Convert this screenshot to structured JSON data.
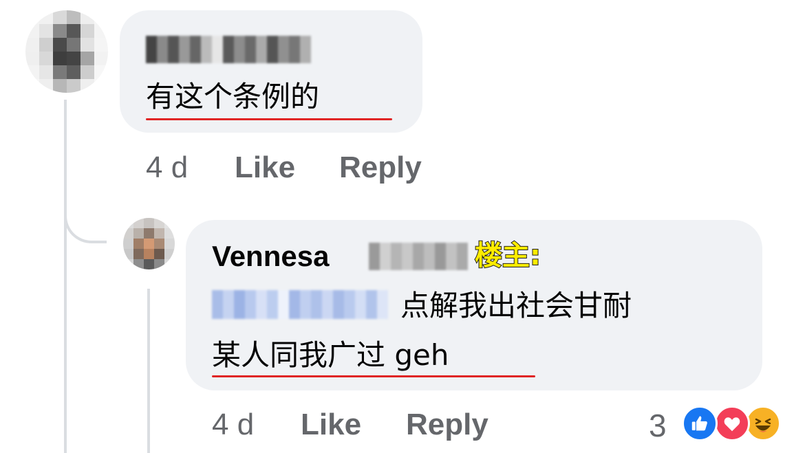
{
  "comment1": {
    "text": "有这个条例的",
    "time": "4 d",
    "like_label": "Like",
    "reply_label": "Reply"
  },
  "reply1": {
    "author_first": "Vennesa",
    "op_tag": "楼主:",
    "text_line1": "点解我出社会甘耐",
    "text_line2": "某人同我广过 geh",
    "time": "4 d",
    "like_label": "Like",
    "reply_label": "Reply",
    "reaction_count": "3",
    "reactions": [
      "like-icon",
      "love-icon",
      "haha-icon"
    ]
  },
  "colors": {
    "bubble": "#f0f2f5",
    "meta_text": "#65676b",
    "underline": "#e02424",
    "op_tag": "#ffec00",
    "like_blue": "#1877f2",
    "love_red": "#f33e58",
    "haha_yellow": "#f7b125"
  }
}
